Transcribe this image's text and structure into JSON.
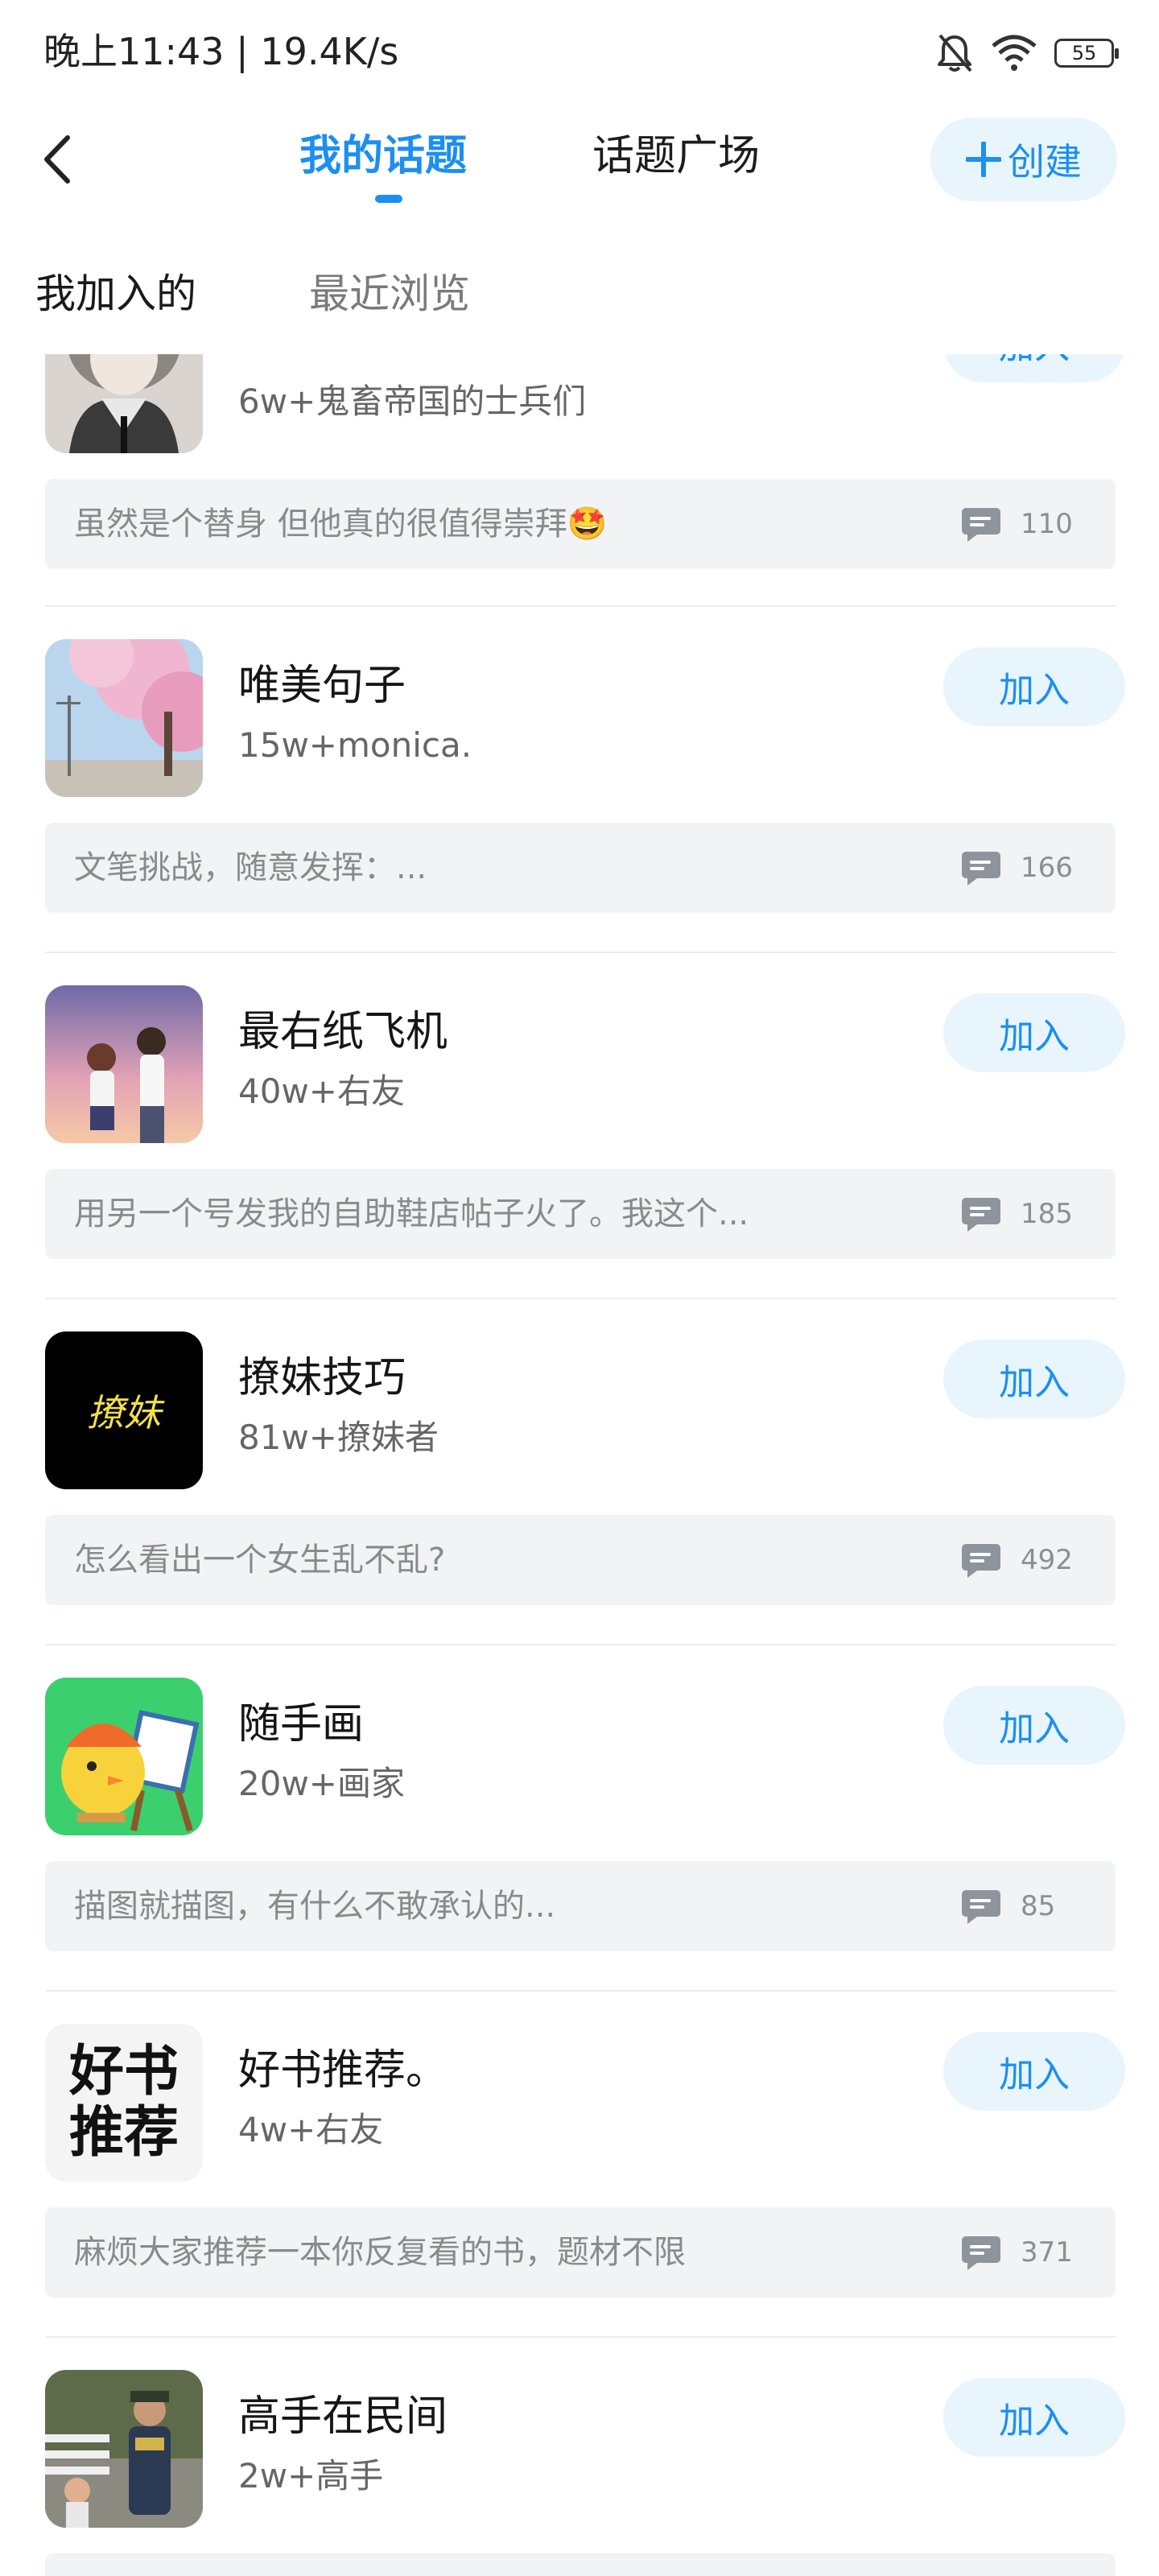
{
  "status_bar": {
    "time": "晚上11:43 | 19.4K/s",
    "battery": "55",
    "icons": [
      "bell-muted-icon",
      "wifi-icon",
      "battery-icon"
    ]
  },
  "header": {
    "tabs": [
      {
        "label": "我的话题",
        "active": true
      },
      {
        "label": "话题广场",
        "active": false
      }
    ],
    "create_label": "创建",
    "accent_color": "#1c8ff0"
  },
  "sub_tabs": [
    {
      "label": "我加入的",
      "active": true
    },
    {
      "label": "最近浏览",
      "active": false
    }
  ],
  "topics": [
    {
      "title": "",
      "subtitle": "6w+鬼畜帝国的士兵们",
      "join_label": "加入",
      "post": "虽然是个替身 但他真的很值得崇拜🤩",
      "comments": "110"
    },
    {
      "title": "唯美句子",
      "subtitle": "15w+monica.",
      "join_label": "加入",
      "post": "文笔挑战，随意发挥：...",
      "comments": "166"
    },
    {
      "title": "最右纸飞机",
      "subtitle": "40w+右友",
      "join_label": "加入",
      "post": "用另一个号发我的自助鞋店帖子火了。我这个...",
      "comments": "185"
    },
    {
      "title": "撩妹技巧",
      "subtitle": "81w+撩妹者",
      "join_label": "加入",
      "post": "怎么看出一个女生乱不乱?",
      "comments": "492",
      "avatar_text": "撩妹"
    },
    {
      "title": "随手画",
      "subtitle": "20w+画家",
      "join_label": "加入",
      "post": "描图就描图，有什么不敢承认的...",
      "comments": "85"
    },
    {
      "title": "好书推荐。",
      "subtitle": "4w+右友",
      "join_label": "加入",
      "post": "麻烦大家推荐一本你反复看的书，题材不限",
      "comments": "371",
      "avatar_text_1": "好书",
      "avatar_text_2": "推荐"
    },
    {
      "title": "高手在民间",
      "subtitle": "2w+高手",
      "join_label": "加入",
      "post": "",
      "comments": ""
    }
  ]
}
